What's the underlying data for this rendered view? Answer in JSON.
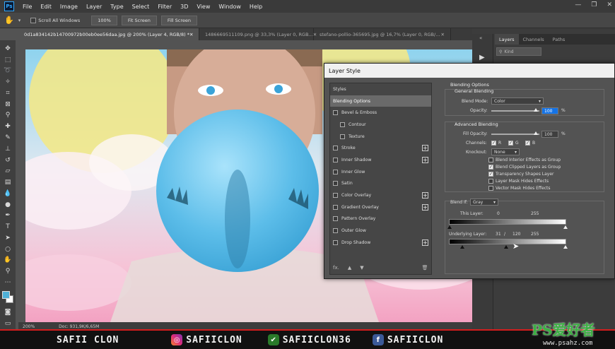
{
  "menubar": {
    "logo": "Ps",
    "items": [
      "File",
      "Edit",
      "Image",
      "Layer",
      "Type",
      "Select",
      "Filter",
      "3D",
      "View",
      "Window",
      "Help"
    ]
  },
  "options_bar": {
    "scroll_all_windows": "Scroll All Windows",
    "zoom_100": "100%",
    "fit_screen": "Fit Screen",
    "fill_screen": "Fill Screen"
  },
  "document_tabs": [
    {
      "label": "0d1a834142b14700972b00eb0ee56daa.jpg @ 200% (Layer 4, RGB/8) *",
      "active": true
    },
    {
      "label": "1486669511109.png @ 33,3% (Layer 0, RGB...",
      "active": false
    },
    {
      "label": "stefano-pollio-365695.jpg @ 16,7% (Layer 0, RGB/...",
      "active": false
    }
  ],
  "status_bar": {
    "zoom": "200%",
    "doc": "Doc: 931,9K/6,65M"
  },
  "layers_panel": {
    "tabs": [
      "Layers",
      "Channels",
      "Paths"
    ],
    "kind": "Kind"
  },
  "layer_style": {
    "title": "Layer Style",
    "styles": [
      {
        "label": "Styles",
        "check": false,
        "plus": false,
        "sub": false,
        "selected": false
      },
      {
        "label": "Blending Options",
        "check": false,
        "plus": false,
        "sub": false,
        "selected": true
      },
      {
        "label": "Bevel & Emboss",
        "check": true,
        "plus": false,
        "sub": false,
        "selected": false
      },
      {
        "label": "Contour",
        "check": true,
        "plus": false,
        "sub": true,
        "selected": false
      },
      {
        "label": "Texture",
        "check": true,
        "plus": false,
        "sub": true,
        "selected": false
      },
      {
        "label": "Stroke",
        "check": true,
        "plus": true,
        "sub": false,
        "selected": false
      },
      {
        "label": "Inner Shadow",
        "check": true,
        "plus": true,
        "sub": false,
        "selected": false
      },
      {
        "label": "Inner Glow",
        "check": true,
        "plus": false,
        "sub": false,
        "selected": false
      },
      {
        "label": "Satin",
        "check": true,
        "plus": false,
        "sub": false,
        "selected": false
      },
      {
        "label": "Color Overlay",
        "check": true,
        "plus": true,
        "sub": false,
        "selected": false
      },
      {
        "label": "Gradient Overlay",
        "check": true,
        "plus": true,
        "sub": false,
        "selected": false
      },
      {
        "label": "Pattern Overlay",
        "check": true,
        "plus": false,
        "sub": false,
        "selected": false
      },
      {
        "label": "Outer Glow",
        "check": true,
        "plus": false,
        "sub": false,
        "selected": false
      },
      {
        "label": "Drop Shadow",
        "check": true,
        "plus": true,
        "sub": false,
        "selected": false
      }
    ],
    "footer_fx": "fx.",
    "blending_options": "Blending Options",
    "general_blending": "General Blending",
    "blend_mode_label": "Blend Mode:",
    "blend_mode_value": "Color",
    "opacity_label": "Opacity:",
    "opacity_value": "100",
    "percent": "%",
    "advanced_blending": "Advanced Blending",
    "fill_opacity_label": "Fill Opacity:",
    "fill_opacity_value": "100",
    "channels_label": "Channels:",
    "channel_r": "R",
    "channel_g": "G",
    "channel_b": "B",
    "knockout_label": "Knockout:",
    "knockout_value": "None",
    "checkboxes": [
      {
        "label": "Blend Interior Effects as Group",
        "checked": false
      },
      {
        "label": "Blend Clipped Layers as Group",
        "checked": true
      },
      {
        "label": "Transparency Shapes Layer",
        "checked": true
      },
      {
        "label": "Layer Mask Hides Effects",
        "checked": false
      },
      {
        "label": "Vector Mask Hides Effects",
        "checked": false
      }
    ],
    "blend_if_label": "Blend If:",
    "blend_if_value": "Gray",
    "this_layer_label": "This Layer:",
    "this_layer_low": "0",
    "this_layer_high": "255",
    "underlying_label": "Underlying Layer:",
    "underlying_a": "31",
    "underlying_sep": "/",
    "underlying_b": "120",
    "underlying_high": "255"
  },
  "footer": {
    "left_name": "SAFII CLON",
    "instagram": "SAFIICLON",
    "other": "SAFIICLON36",
    "facebook": "SAFIICLON"
  },
  "watermark": {
    "brand": "PS爱好者",
    "site": "www.psahz.com"
  },
  "colors": {
    "accent": "#1473e6",
    "footer_red": "#d31d1d",
    "foreground_swatch": "#4fb0d6"
  }
}
